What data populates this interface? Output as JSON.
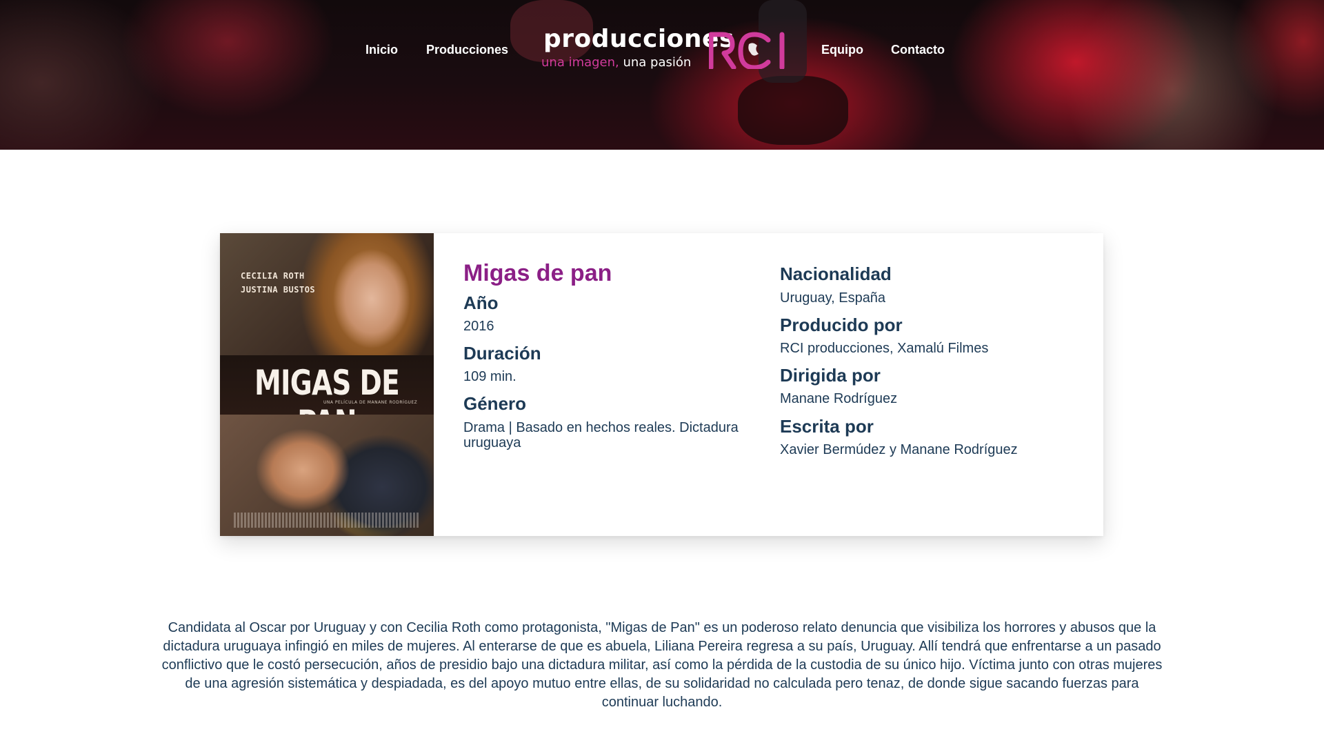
{
  "nav": {
    "inicio": "Inicio",
    "producciones": "Producciones",
    "equipo": "Equipo",
    "contacto": "Contacto"
  },
  "logo": {
    "wordmark": "producciones",
    "slogan_pink": "una imagen,",
    "slogan_white": " una pasión",
    "mark": "RCI"
  },
  "poster": {
    "title": "MIGAS DE PAN",
    "cast": [
      "CECILIA ROTH",
      "JUSTINA BUSTOS"
    ],
    "subtitle": "UNA PELÍCULA DE MANANE RODRÍGUEZ"
  },
  "film": {
    "title": "Migas de pan",
    "year_label": "Año",
    "year": "2016",
    "duration_label": "Duración",
    "duration": "109 min.",
    "genre_label": "Género",
    "genre": "Drama | Basado en hechos reales. Dictadura uruguaya",
    "nationality_label": "Nacionalidad",
    "nationality": "Uruguay, España",
    "produced_label": "Producido por",
    "produced": "RCI producciones, Xamalú Filmes",
    "directed_label": "Dirigida por",
    "directed": "Manane Rodríguez",
    "written_label": "Escrita por",
    "written": "Xavier Bermúdez y Manane Rodríguez"
  },
  "synopsis": "Candidata al Oscar por Uruguay y con Cecilia Roth como protagonista, \"Migas de Pan\" es un poderoso relato denuncia que visibiliza los horrores y abusos que la dictadura uruguaya infingió en miles de mujeres. Al enterarse de que es abuela, Liliana Pereira regresa a su país, Uruguay. Allí tendrá que enfrentarse a un pasado conflictivo que le costó persecución, años de presidio bajo una dictadura militar, así como la pérdida de la custodia de su único hijo. Víctima junto con otras mujeres de una agresión sistemática y despiadada, es del apoyo mutuo entre ellas, de su solidaridad no calculada pero tenaz, de donde sigue sacando fuerzas para continuar luchando.",
  "colors": {
    "accent": "#8b1f86",
    "text": "#1d3a55",
    "logo_pink": "#d13b9c"
  }
}
